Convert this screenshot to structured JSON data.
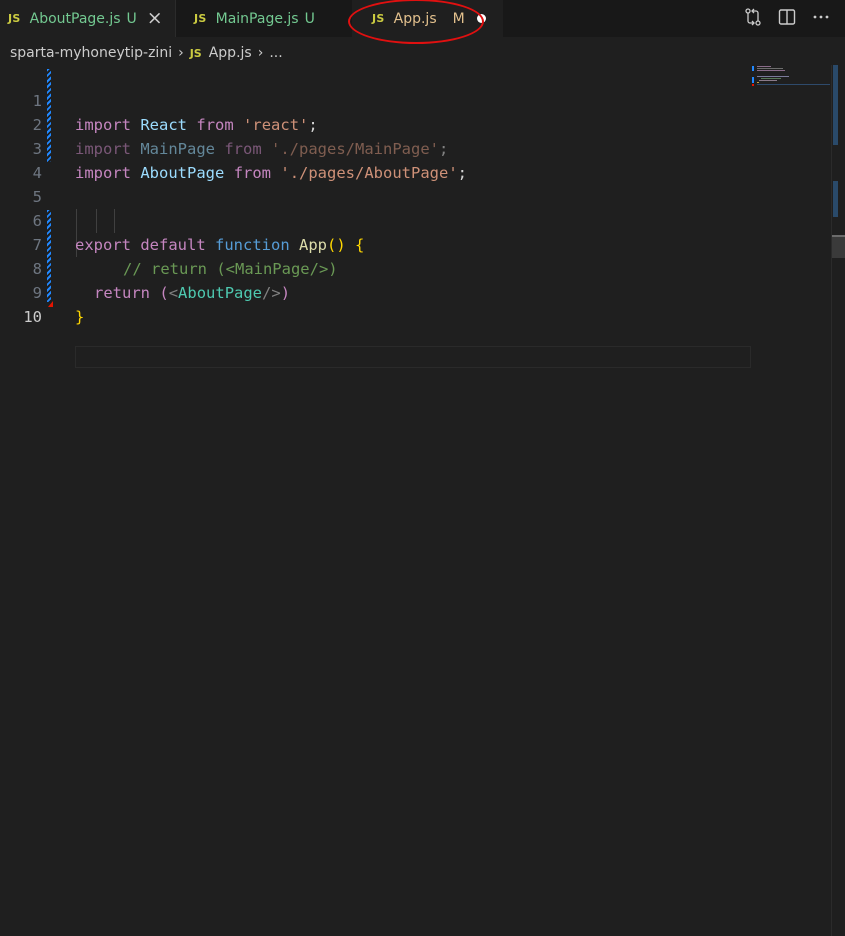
{
  "tabs": [
    {
      "lang_badge": "JS",
      "label": "AboutPage.js",
      "status": "U",
      "close": "×"
    },
    {
      "lang_badge": "JS",
      "label": "MainPage.js",
      "status": "U"
    },
    {
      "lang_badge": "JS",
      "label": "App.js",
      "status": "M"
    }
  ],
  "breadcrumb": {
    "folder": "sparta-myhoneytip-zini",
    "lang_badge": "JS",
    "file": "App.js",
    "more": "..."
  },
  "editor": {
    "line_numbers": [
      "1",
      "2",
      "3",
      "4",
      "5",
      "6",
      "7",
      "8",
      "9",
      "10"
    ],
    "active_line": "10"
  },
  "colors": {
    "untracked": "#73c991",
    "modified": "#e2c08d",
    "annotation": "#e01010"
  }
}
